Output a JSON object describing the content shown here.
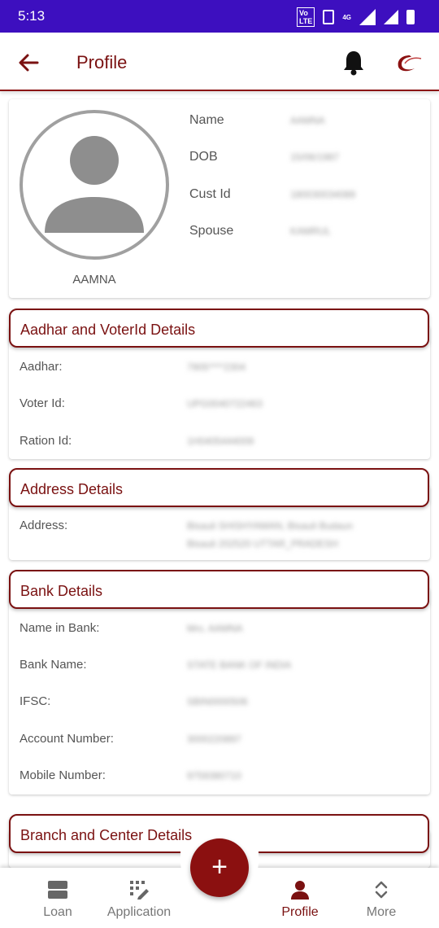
{
  "status_bar": {
    "time": "5:13",
    "network": "4G"
  },
  "app_bar": {
    "title": "Profile"
  },
  "profile": {
    "name": "AAMNA",
    "fields": [
      {
        "label": "Name",
        "value": "AAMNA"
      },
      {
        "label": "DOB",
        "value": "15/06/1987"
      },
      {
        "label": "Cust Id",
        "value": "180030034089"
      },
      {
        "label": "Spouse",
        "value": "KAMRUL"
      }
    ]
  },
  "aadhar_section": {
    "title": "Aadhar and VoterId Details",
    "rows": [
      {
        "label": "Aadhar:",
        "value": "7905****2304"
      },
      {
        "label": "Voter Id:",
        "value": "UPG0040722463"
      },
      {
        "label": "Ration Id:",
        "value": "1H0405444009"
      }
    ]
  },
  "address_section": {
    "title": "Address Details",
    "rows": [
      {
        "label": "Address:",
        "value_line1": "Bisauli SHISHYAMAN, Bisauli Budaun",
        "value_line2": "Bisauli 202520 UTTAR_PRADESH"
      }
    ]
  },
  "bank_section": {
    "title": "Bank Details",
    "rows": [
      {
        "label": "Name in Bank:",
        "value": "Mrs. AAMNA"
      },
      {
        "label": "Bank Name:",
        "value": "STATE BANK OF INDIA"
      },
      {
        "label": "IFSC:",
        "value": "SBIN0000506"
      },
      {
        "label": "Account Number:",
        "value": "3000220897"
      },
      {
        "label": "Mobile Number:",
        "value": "9759380710"
      }
    ]
  },
  "branch_section": {
    "title": "Branch and Center Details"
  },
  "bottom_nav": {
    "items": [
      {
        "label": "Loan",
        "icon": "loan-icon"
      },
      {
        "label": "Application",
        "icon": "application-icon"
      },
      {
        "label": "Profile",
        "icon": "person-icon"
      },
      {
        "label": "More",
        "icon": "expand-icon"
      }
    ],
    "fab_label": "+"
  },
  "colors": {
    "accent": "#7a1111",
    "status_bar": "#3d0fbf",
    "fab": "#8b1010"
  }
}
